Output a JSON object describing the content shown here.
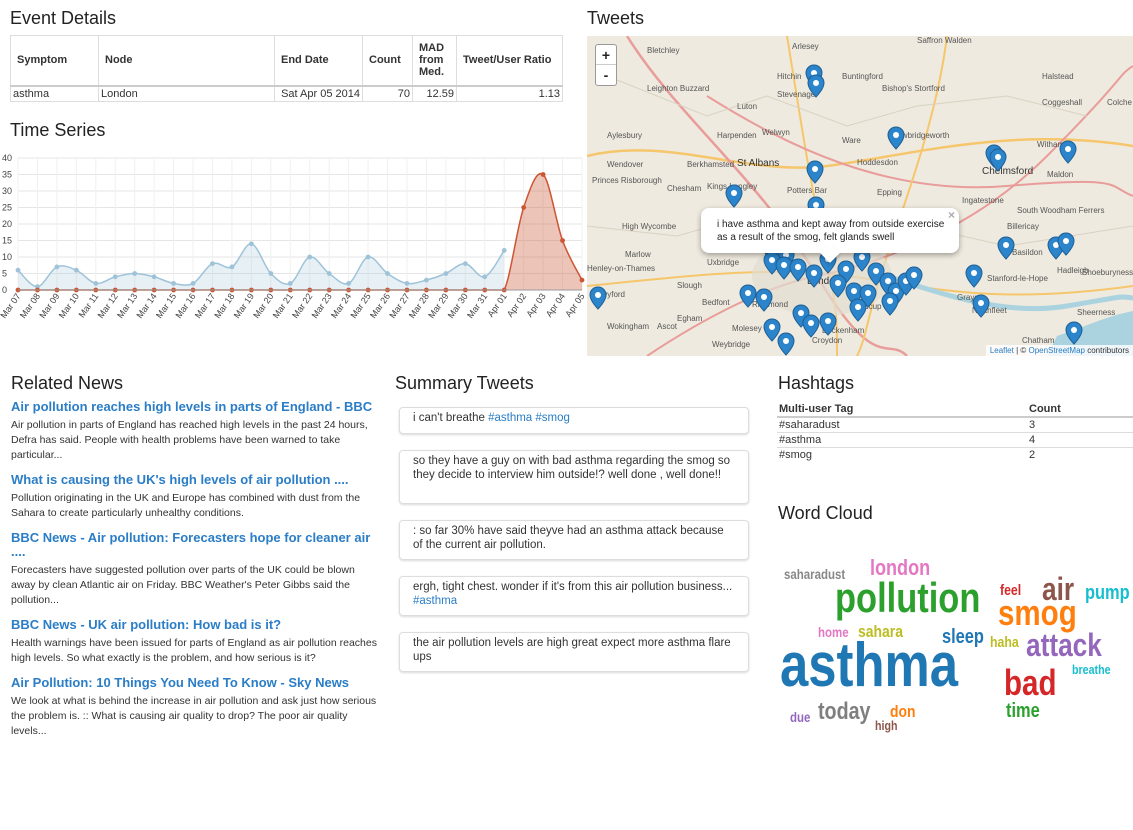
{
  "event_details": {
    "heading": "Event Details",
    "columns": [
      "Symptom",
      "Node",
      "End Date",
      "Count",
      "MAD from Med.",
      "Tweet/User Ratio"
    ],
    "row": [
      "asthma",
      "London",
      "Sat Apr 05 2014",
      "70",
      "12.59",
      "1.13"
    ]
  },
  "time_series": {
    "heading": "Time Series"
  },
  "chart_data": {
    "type": "area",
    "categories": [
      "Mar 07",
      "Mar 08",
      "Mar 09",
      "Mar 10",
      "Mar 11",
      "Mar 12",
      "Mar 13",
      "Mar 14",
      "Mar 15",
      "Mar 16",
      "Mar 17",
      "Mar 18",
      "Mar 19",
      "Mar 20",
      "Mar 21",
      "Mar 22",
      "Mar 23",
      "Mar 24",
      "Mar 25",
      "Mar 26",
      "Mar 27",
      "Mar 28",
      "Mar 29",
      "Mar 30",
      "Mar 31",
      "Apr 01",
      "Apr 02",
      "Apr 03",
      "Apr 04",
      "Apr 05"
    ],
    "series": [
      {
        "values": [
          6,
          1,
          7,
          6,
          2,
          4,
          5,
          4,
          2,
          2,
          8,
          7,
          14,
          5,
          2,
          10,
          5,
          2,
          10,
          5,
          2,
          3,
          5,
          8,
          4,
          12,
          null,
          null,
          null,
          null
        ],
        "color": "#9ec3d9"
      },
      {
        "values": [
          0,
          0,
          0,
          0,
          0,
          0,
          0,
          0,
          0,
          0,
          0,
          0,
          0,
          0,
          0,
          0,
          0,
          0,
          0,
          0,
          0,
          0,
          0,
          0,
          0,
          0,
          25,
          35,
          15,
          3
        ],
        "color": "#cc5533"
      }
    ],
    "yticks": [
      0,
      5,
      10,
      15,
      20,
      25,
      30,
      35,
      40
    ],
    "ylim": [
      0,
      40
    ],
    "grid": true
  },
  "tweets": {
    "heading": "Tweets",
    "zoom_in": "+",
    "zoom_out": "-",
    "popup_text": "i have asthma and kept away from outside exercise as a result of the smog, felt glands swell",
    "popup_close": "×",
    "attribution_leaflet": "Leaflet",
    "attribution_sep": " | © ",
    "attribution_osm": "OpenStreetMap",
    "attribution_rest": " contributors",
    "places": [
      "Bletchley",
      "Arlesey",
      "Saffron Walden",
      "Hitchin",
      "Buntingford",
      "Halstead",
      "Leighton Buzzard",
      "Stevenage",
      "Bishop's Stortford",
      "Coggeshall",
      "Colche",
      "Luton",
      "Aylesbury",
      "Harpenden",
      "Welwyn",
      "Ware",
      "Sawbridgeworth",
      "Witham",
      "Wendover",
      "Berkhamsted",
      "St Albans",
      "Hoddesdon",
      "Chelmsford",
      "Maldon",
      "Princes Risborough",
      "Chesham",
      "Kings Langley",
      "Potters Bar",
      "Epping",
      "Ingatestone",
      "High Wycombe",
      "Billericay",
      "South Woodham Ferrers",
      "Marlow",
      "Basildon",
      "Hadleigh",
      "Shoeburyness",
      "Henley-on-Thames",
      "Uxbridge",
      "Slough",
      "Stanford-le-Hope",
      "Twyford",
      "Bedfont",
      "Richmond",
      "London",
      "Grays",
      "Wokingham",
      "Ascot",
      "Egham",
      "Northfleet",
      "Sheerness",
      "Molesey",
      "Sidcup",
      "Weybridge",
      "Beckenham",
      "Croydon",
      "Chatham"
    ]
  },
  "related_news": {
    "heading": "Related News",
    "items": [
      {
        "title": "Air pollution reaches high levels in parts of England - BBC",
        "desc": "Air pollution in parts of England has reached high levels in the past 24 hours, Defra has said. People with health problems have been warned to take particular..."
      },
      {
        "title": "What is causing the UK's high levels of air pollution ....",
        "desc": "Pollution originating in the UK and Europe has combined with dust from the Sahara to create particularly unhealthy conditions."
      },
      {
        "title": "BBC News - Air pollution: Forecasters hope for cleaner air ....",
        "desc": "Forecasters have suggested pollution over parts of the UK could be blown away by clean Atlantic air on Friday. BBC Weather's Peter Gibbs said the pollution..."
      },
      {
        "title": "BBC News - UK air pollution: How bad is it?",
        "desc": "Health warnings have been issued for parts of England as air pollution reaches high levels. So what exactly is the problem, and how serious is it?"
      },
      {
        "title": "Air Pollution: 10 Things You Need To Know - Sky News",
        "desc": "We look at what is behind the increase in air pollution and ask just how serious the problem is. :: What is causing air quality to drop? The poor air quality levels..."
      }
    ]
  },
  "summary_tweets": {
    "heading": "Summary Tweets",
    "items": [
      {
        "text": "i can't breathe ",
        "tag": "#asthma #smog"
      },
      {
        "text": "so they have a guy on with bad asthma regarding the smog so they decide to interview him outside!? well done , well done!!",
        "tag": ""
      },
      {
        "text": ": so far 30% have said theyve had an asthma attack because of the current air pollution.",
        "tag": ""
      },
      {
        "text": "ergh, tight chest. wonder if it's from this air pollution business... ",
        "tag": "#asthma"
      },
      {
        "text": "the air pollution levels are high great expect more asthma flare ups",
        "tag": ""
      }
    ]
  },
  "hashtags": {
    "heading": "Hashtags",
    "columns": [
      "Multi-user Tag",
      "Count"
    ],
    "rows": [
      [
        "#saharadust",
        "3"
      ],
      [
        "#asthma",
        "4"
      ],
      [
        "#smog",
        "2"
      ]
    ]
  },
  "word_cloud": {
    "heading": "Word Cloud",
    "words": [
      {
        "text": "saharadust",
        "color": "#888888"
      },
      {
        "text": "london",
        "color": "#e377c2"
      },
      {
        "text": "pollution",
        "color": "#2ca02c"
      },
      {
        "text": "feel",
        "color": "#d62728"
      },
      {
        "text": "air",
        "color": "#8c564b"
      },
      {
        "text": "pump",
        "color": "#17becf"
      },
      {
        "text": "smog",
        "color": "#ff7f0e"
      },
      {
        "text": "home",
        "color": "#e377c2"
      },
      {
        "text": "sahara",
        "color": "#bcbd22"
      },
      {
        "text": "sleep",
        "color": "#1f77b4"
      },
      {
        "text": "haha",
        "color": "#bcbd22"
      },
      {
        "text": "attack",
        "color": "#9467bd"
      },
      {
        "text": "breathe",
        "color": "#17becf"
      },
      {
        "text": "asthma",
        "color": "#1f77b4"
      },
      {
        "text": "bad",
        "color": "#d62728"
      },
      {
        "text": "due",
        "color": "#9467bd"
      },
      {
        "text": "today",
        "color": "#7f7f7f"
      },
      {
        "text": "don",
        "color": "#ff7f0e"
      },
      {
        "text": "time",
        "color": "#2ca02c"
      },
      {
        "text": "high",
        "color": "#8c564b"
      }
    ]
  }
}
